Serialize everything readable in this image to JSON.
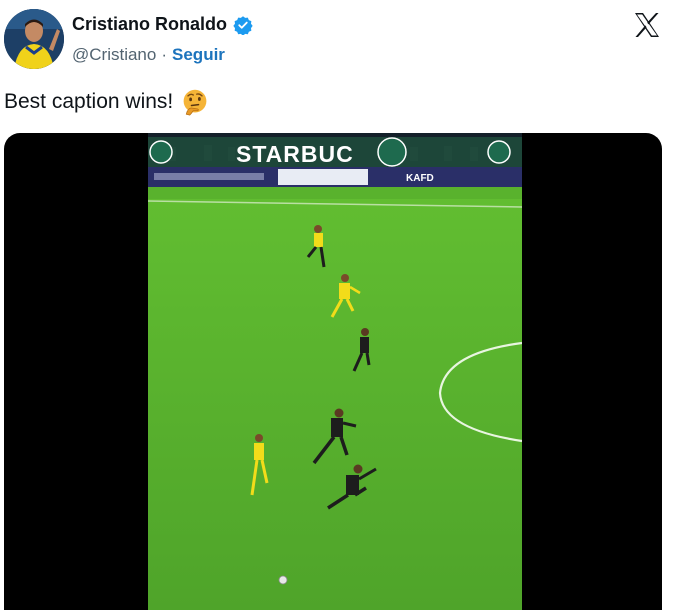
{
  "author": {
    "name": "Cristiano Ronaldo",
    "handle": "@Cristiano",
    "separator": "·",
    "follow_label": "Seguir"
  },
  "icons": {
    "verified": "verified-badge-icon",
    "platform": "x-logo-icon",
    "emoji": "thinking-face-emoji"
  },
  "tweet": {
    "text": "Best caption wins!"
  },
  "video": {
    "board_text": "STARBUC",
    "sponsor_text": "KAFD"
  },
  "colors": {
    "verified": "#1d9bf0",
    "follow": "#1d74bd",
    "pitch": "#5cb82f",
    "yellow_kit": "#f2dc1a",
    "dark_kit": "#1d1d1d"
  }
}
